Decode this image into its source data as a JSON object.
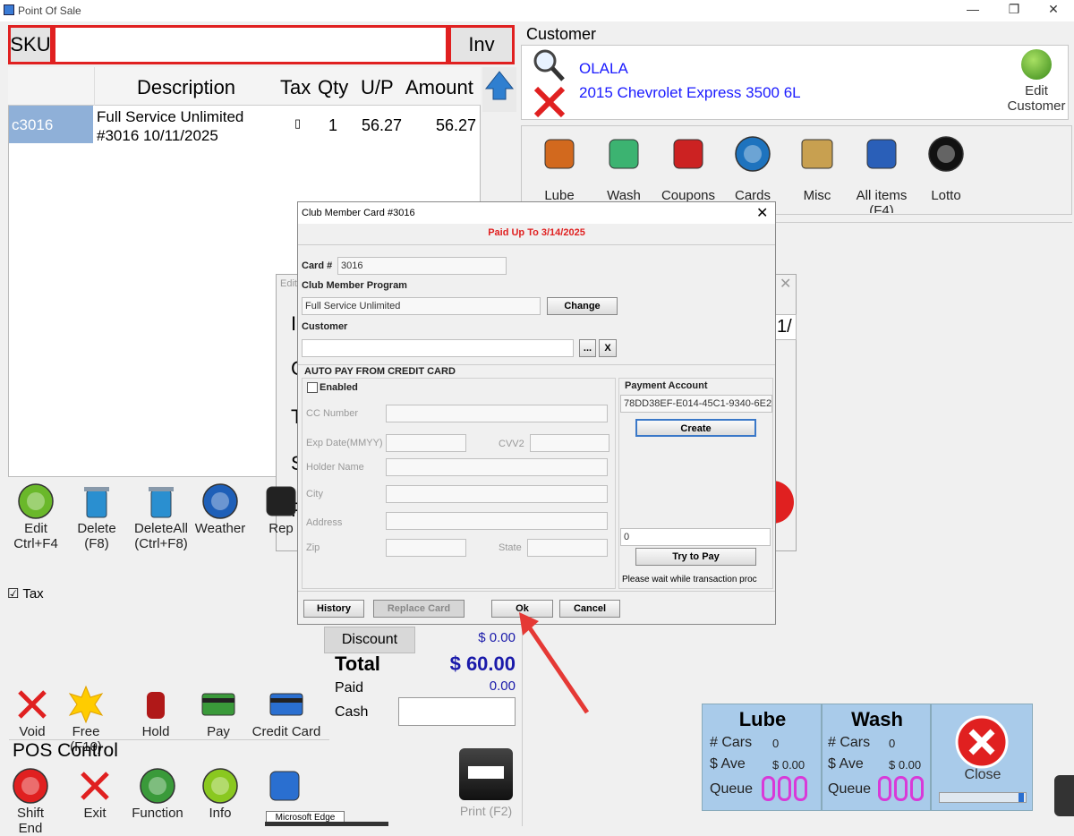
{
  "window": {
    "title": "Point Of Sale"
  },
  "sku": {
    "label": "SKU",
    "value": "",
    "inv_label": "Inv"
  },
  "grid": {
    "headers": [
      "Description",
      "Tax",
      "Qty",
      "U/P",
      "Amount"
    ],
    "rows": [
      {
        "code": "c3016",
        "desc1": "Full Service Unlimited",
        "desc2": "#3016 10/11/2025",
        "tax": "▯",
        "qty": "1",
        "up": "56.27",
        "amount": "56.27"
      }
    ]
  },
  "customer": {
    "section": "Customer",
    "name": "OLALA",
    "vehicle": "2015 Chevrolet Express 3500 6L",
    "edit_label1": "Edit",
    "edit_label2": "Customer"
  },
  "categories": [
    {
      "label": "Lube",
      "icon": "lube-icon",
      "color": "#d2691e"
    },
    {
      "label": "Wash",
      "icon": "wash-icon",
      "color": "#3cb371"
    },
    {
      "label": "Coupons",
      "icon": "coupons-icon",
      "color": "#cc2222"
    },
    {
      "label": "Cards",
      "icon": "cards-icon",
      "color": "#1e73be"
    },
    {
      "label": "Misc",
      "icon": "misc-icon",
      "color": "#c8a050"
    },
    {
      "label": "All items",
      "sub": "(F4)",
      "icon": "all-items-icon",
      "color": "#2a5fb8"
    },
    {
      "label": "Lotto",
      "icon": "lotto-icon",
      "color": "#111111"
    }
  ],
  "line_tools": [
    {
      "l1": "Edit",
      "l2": "Ctrl+F4",
      "icon": "edit-icon"
    },
    {
      "l1": "Delete",
      "l2": "(F8)",
      "icon": "trash-icon"
    },
    {
      "l1": "DeleteAll",
      "l2": "(Ctrl+F8)",
      "icon": "trash-all-icon"
    },
    {
      "l1": "Weather",
      "l2": "",
      "icon": "weather-icon"
    },
    {
      "l1": "Rep",
      "l2": "",
      "icon": "report-icon"
    }
  ],
  "tax_label": "Tax",
  "actions": [
    {
      "label": "Void",
      "icon": "void-icon"
    },
    {
      "label": "Free (F10)",
      "icon": "free-icon",
      "badge": "Free"
    },
    {
      "label": "Hold",
      "icon": "hold-icon"
    },
    {
      "label": "Pay",
      "icon": "pay-icon"
    },
    {
      "label": "Credit Card",
      "icon": "credit-card-icon"
    }
  ],
  "pos_control": {
    "title": "POS Control",
    "items": [
      {
        "label": "Shift End",
        "icon": "shift-end-icon"
      },
      {
        "label": "Exit",
        "icon": "exit-icon"
      },
      {
        "label": "Function",
        "icon": "function-icon"
      },
      {
        "label": "Info",
        "icon": "info-icon"
      },
      {
        "label": "",
        "icon": "users-icon"
      }
    ],
    "tooltip": "Microsoft Edge"
  },
  "totals": {
    "discount_label": "Discount",
    "discount": "$ 0.00",
    "total_label": "Total",
    "total": "$ 60.00",
    "paid_label": "Paid",
    "paid": "0.00",
    "cash_label": "Cash",
    "cash": ""
  },
  "print_label": "Print (F2)",
  "counters": {
    "lube": {
      "title": "Lube",
      "cars_label": "# Cars",
      "cars": "0",
      "ave_label": "$ Ave",
      "ave": "$ 0.00",
      "queue_label": "Queue"
    },
    "wash": {
      "title": "Wash",
      "cars_label": "# Cars",
      "cars": "0",
      "ave_label": "$ Ave",
      "ave": "$ 0.00",
      "queue_label": "Queue"
    },
    "close_label": "Close"
  },
  "bg_dialog": {
    "title": "Edit",
    "letters": [
      "I",
      "C",
      "T",
      "S",
      "P"
    ],
    "right_text": "1/"
  },
  "dialog": {
    "title": "Club Member Card #3016",
    "paid_up": "Paid Up To 3/14/2025",
    "card_label": "Card #",
    "card_value": "3016",
    "program_label": "Club Member Program",
    "program_value": "Full Service Unlimited",
    "change_label": "Change",
    "customer_label": "Customer",
    "customer_value": "",
    "dots_label": "...",
    "x_label": "X",
    "autopay_label": "AUTO PAY FROM CREDIT CARD",
    "enabled_label": "Enabled",
    "cc_label": "CC Number",
    "exp_label": "Exp Date(MMYY)",
    "cvv_label": "CVV2",
    "holder_label": "Holder Name",
    "city_label": "City",
    "address_label": "Address",
    "zip_label": "Zip",
    "state_label": "State",
    "payment_account_label": "Payment Account",
    "payment_account_value": "78DD38EF-E014-45C1-9340-6E2",
    "create_label": "Create",
    "amount_value": "0",
    "try_label": "Try to Pay",
    "status_text": "Please wait while transaction proc",
    "history_label": "History",
    "replace_label": "Replace Card",
    "ok_label": "Ok",
    "cancel_label": "Cancel"
  },
  "annotation_color": "#e53935"
}
